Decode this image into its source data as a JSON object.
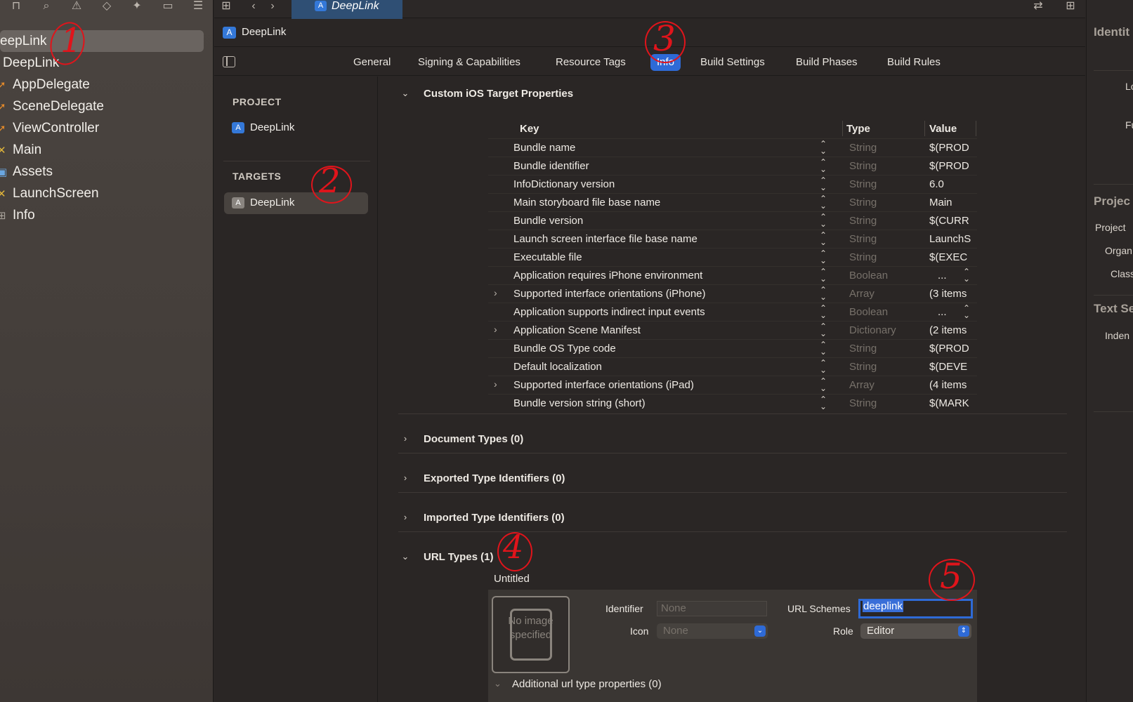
{
  "toolbar": {
    "nav_icons": [
      "hierarchy-icon",
      "search-icon",
      "warning-icon",
      "test-icon",
      "debug-icon",
      "breakpoint-icon",
      "report-icon"
    ],
    "tab_title": "DeepLink"
  },
  "navigator": {
    "root": "eepLink",
    "group": "DeepLink",
    "files": [
      {
        "label": "AppDelegate",
        "icon": "swift-icon"
      },
      {
        "label": "SceneDelegate",
        "icon": "swift-icon"
      },
      {
        "label": "ViewController",
        "icon": "swift-icon"
      },
      {
        "label": "Main",
        "icon": "storyboard-icon"
      },
      {
        "label": "Assets",
        "icon": "assets-icon"
      },
      {
        "label": "LaunchScreen",
        "icon": "storyboard-icon"
      },
      {
        "label": "Info",
        "icon": "plist-icon"
      }
    ]
  },
  "jump_bar": {
    "label": "DeepLink"
  },
  "settings_tabs": [
    "General",
    "Signing & Capabilities",
    "Resource Tags",
    "Info",
    "Build Settings",
    "Build Phases",
    "Build Rules"
  ],
  "targets_list": {
    "project_header": "PROJECT",
    "project_item": "DeepLink",
    "targets_header": "TARGETS",
    "target_item": "DeepLink"
  },
  "custom_props": {
    "title": "Custom iOS Target Properties",
    "columns": {
      "key": "Key",
      "type": "Type",
      "value": "Value"
    },
    "rows": [
      {
        "key": "Bundle name",
        "type": "String",
        "value": "$(PROD"
      },
      {
        "key": "Bundle identifier",
        "type": "String",
        "value": "$(PROD"
      },
      {
        "key": "InfoDictionary version",
        "type": "String",
        "value": "6.0"
      },
      {
        "key": "Main storyboard file base name",
        "type": "String",
        "value": "Main"
      },
      {
        "key": "Bundle version",
        "type": "String",
        "value": "$(CURR"
      },
      {
        "key": "Launch screen interface file base name",
        "type": "String",
        "value": "LaunchS"
      },
      {
        "key": "Executable file",
        "type": "String",
        "value": "$(EXEC"
      },
      {
        "key": "Application requires iPhone environment",
        "type": "Boolean",
        "value": "..."
      },
      {
        "key": "Supported interface orientations (iPhone)",
        "type": "Array",
        "value": "(3 items"
      },
      {
        "key": "Application supports indirect input events",
        "type": "Boolean",
        "value": "..."
      },
      {
        "key": "Application Scene Manifest",
        "type": "Dictionary",
        "value": "(2 items"
      },
      {
        "key": "Bundle OS Type code",
        "type": "String",
        "value": "$(PROD"
      },
      {
        "key": "Default localization",
        "type": "String",
        "value": "$(DEVE"
      },
      {
        "key": "Supported interface orientations (iPad)",
        "type": "Array",
        "value": "(4 items"
      },
      {
        "key": "Bundle version string (short)",
        "type": "String",
        "value": "$(MARK"
      }
    ]
  },
  "sections": {
    "document_types": "Document Types (0)",
    "exported_types": "Exported Type Identifiers (0)",
    "imported_types": "Imported Type Identifiers (0)",
    "url_types": "URL Types (1)"
  },
  "url_type": {
    "name": "Untitled",
    "image_placeholder": "No image specified",
    "identifier_label": "Identifier",
    "identifier_placeholder": "None",
    "icon_label": "Icon",
    "icon_value": "None",
    "url_schemes_label": "URL Schemes",
    "url_schemes_value": "deeplink",
    "role_label": "Role",
    "role_value": "Editor",
    "additional": "Additional url type properties (0)"
  },
  "inspector": {
    "identity_head": "Identit",
    "lo": "Lo",
    "fu": "Fu",
    "project_head": "Projec",
    "project_label": "Project",
    "organ_label": "Organ",
    "class_label": "Class",
    "text_head": "Text Se",
    "indent_label": "Inden"
  },
  "annotations": [
    "1",
    "2",
    "3",
    "4",
    "5"
  ],
  "colors": {
    "accent": "#2e6ad6",
    "annotation": "#e0141b",
    "background": "#2a2625"
  }
}
